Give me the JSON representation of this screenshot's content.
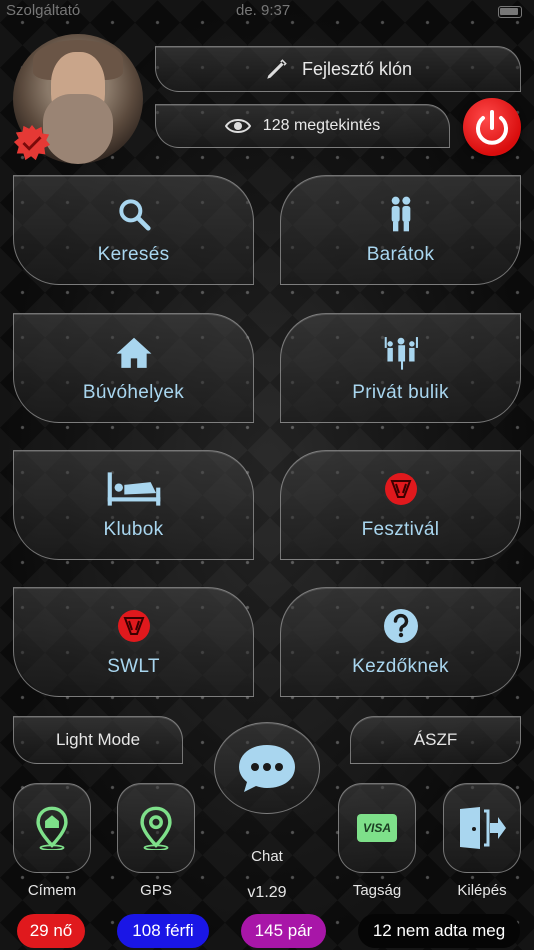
{
  "status_bar": {
    "carrier": "Szolgáltató",
    "time": "de. 9:37"
  },
  "profile": {
    "avatar_desc": "",
    "verified_badge_color": "#e53935"
  },
  "header": {
    "dev_clone_label": "Fejlesztő klón",
    "views_label": "128 megtekintés",
    "power_color": "#e0191d"
  },
  "tiles": {
    "search": "Keresés",
    "friends": "Barátok",
    "hideouts": "Búvóhelyek",
    "private_party": "Privát bulik",
    "clubs": "Klubok",
    "festival": "Fesztivál",
    "swlt": "SWLT",
    "beginners": "Kezdőknek"
  },
  "bottom": {
    "light_mode": "Light Mode",
    "aszf": "ÁSZF",
    "chat": "Chat",
    "address": "Címem",
    "gps": "GPS",
    "version": "v1.29",
    "membership": "Tagság",
    "logout": "Kilépés",
    "visa": "VISA"
  },
  "counters": {
    "women": "29 nő",
    "men": "108 férfi",
    "couples": "145 pár",
    "unspecified": "12 nem adta meg"
  },
  "colors": {
    "accent_blue": "#a9d6ef",
    "women_bg": "#e0191d",
    "men_bg": "#1a16e6",
    "couples_bg": "#a816a8",
    "unspecified_bg": "#050505",
    "icon_green": "#7ee08a"
  }
}
